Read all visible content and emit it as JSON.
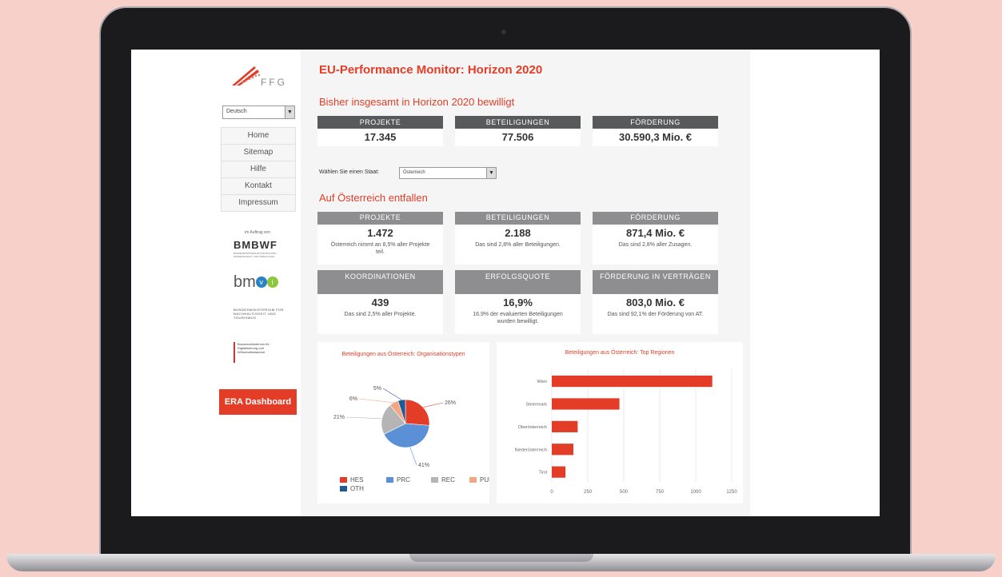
{
  "sidebar": {
    "logo_text": "FFG",
    "language": "Deutsch",
    "nav": [
      "Home",
      "Sitemap",
      "Hilfe",
      "Kontakt",
      "Impressum"
    ],
    "auftrag": "im Auftrag von",
    "bmbwf": "BMBWF",
    "bmbwf_sub": "BUNDESMINISTERIUM FÜR BILDUNG, WISSENSCHAFT UND FORSCHUNG",
    "bmvit_prefix": "bm",
    "bmvit_v": "v",
    "bmvit_i": "i",
    "bmnt": "BUNDESMINISTERIUM FÜR NACHHALTIGKEIT UND TOURISMUS",
    "bmdw": "Bundesministerium für Digitalisierung und Wirtschaftsstandort",
    "era_button": "ERA Dashboard"
  },
  "main": {
    "title": "EU-Performance Monitor: Horizon 2020",
    "total_heading": "Bisher insgesamt in Horizon 2020 bewilligt",
    "totals": [
      {
        "label": "PROJEKTE",
        "value": "17.345"
      },
      {
        "label": "BETEILIGUNGEN",
        "value": "77.506"
      },
      {
        "label": "FÖRDERUNG",
        "value": "30.590,3 Mio. €"
      }
    ],
    "state_label": "Wählen Sie einen Staat:",
    "state_value": "Österreich",
    "austria_heading": "Auf Österreich entfallen",
    "austria_row1": [
      {
        "label": "PROJEKTE",
        "value": "1.472",
        "note": "Österreich nimmt an 8,5% aller Projekte teil."
      },
      {
        "label": "BETEILIGUNGEN",
        "value": "2.188",
        "note": "Das sind 2,8% aller Beteiligungen."
      },
      {
        "label": "FÖRDERUNG",
        "value": "871,4 Mio. €",
        "note": "Das sind 2,8% aller Zusagen."
      }
    ],
    "austria_row2": [
      {
        "label": "KOORDINATIONEN",
        "value": "439",
        "note": "Das sind 2,5% aller Projekte."
      },
      {
        "label": "ERFOLGSQUOTE",
        "value": "16,9%",
        "note": "16,9% der evaluierten Beteiligungen wurden bewilligt."
      },
      {
        "label": "FÖRDERUNG IN VERTRÄGEN",
        "value": "803,0 Mio. €",
        "note": "Das sind 92,1% der Förderung von AT."
      }
    ]
  },
  "chart_data": [
    {
      "type": "pie",
      "title": "Beteiligungen aus Österreich: Organisationstypen",
      "categories": [
        "HES",
        "PRC",
        "REC",
        "PUB",
        "OTH"
      ],
      "values": [
        26,
        41,
        21,
        6,
        5
      ],
      "labels": [
        "26%",
        "41%",
        "21%",
        "6%",
        "5%"
      ],
      "colors": [
        "#e43d27",
        "#5b8fd6",
        "#b5b5b5",
        "#f4a582",
        "#1f5a96"
      ],
      "legend": "bottom"
    },
    {
      "type": "bar",
      "orientation": "horizontal",
      "title": "Beteiligungen aus Österreich: Top Regionen",
      "categories": [
        "Wien",
        "Steiermark",
        "Oberösterreich",
        "Niederösterreich",
        "Tirol"
      ],
      "values": [
        1115,
        470,
        180,
        150,
        95
      ],
      "xlim": [
        0,
        1250
      ],
      "xticks": [
        "0",
        "250",
        "500",
        "750",
        "1000",
        "1250"
      ],
      "color": "#e43d27",
      "grid": true
    }
  ]
}
